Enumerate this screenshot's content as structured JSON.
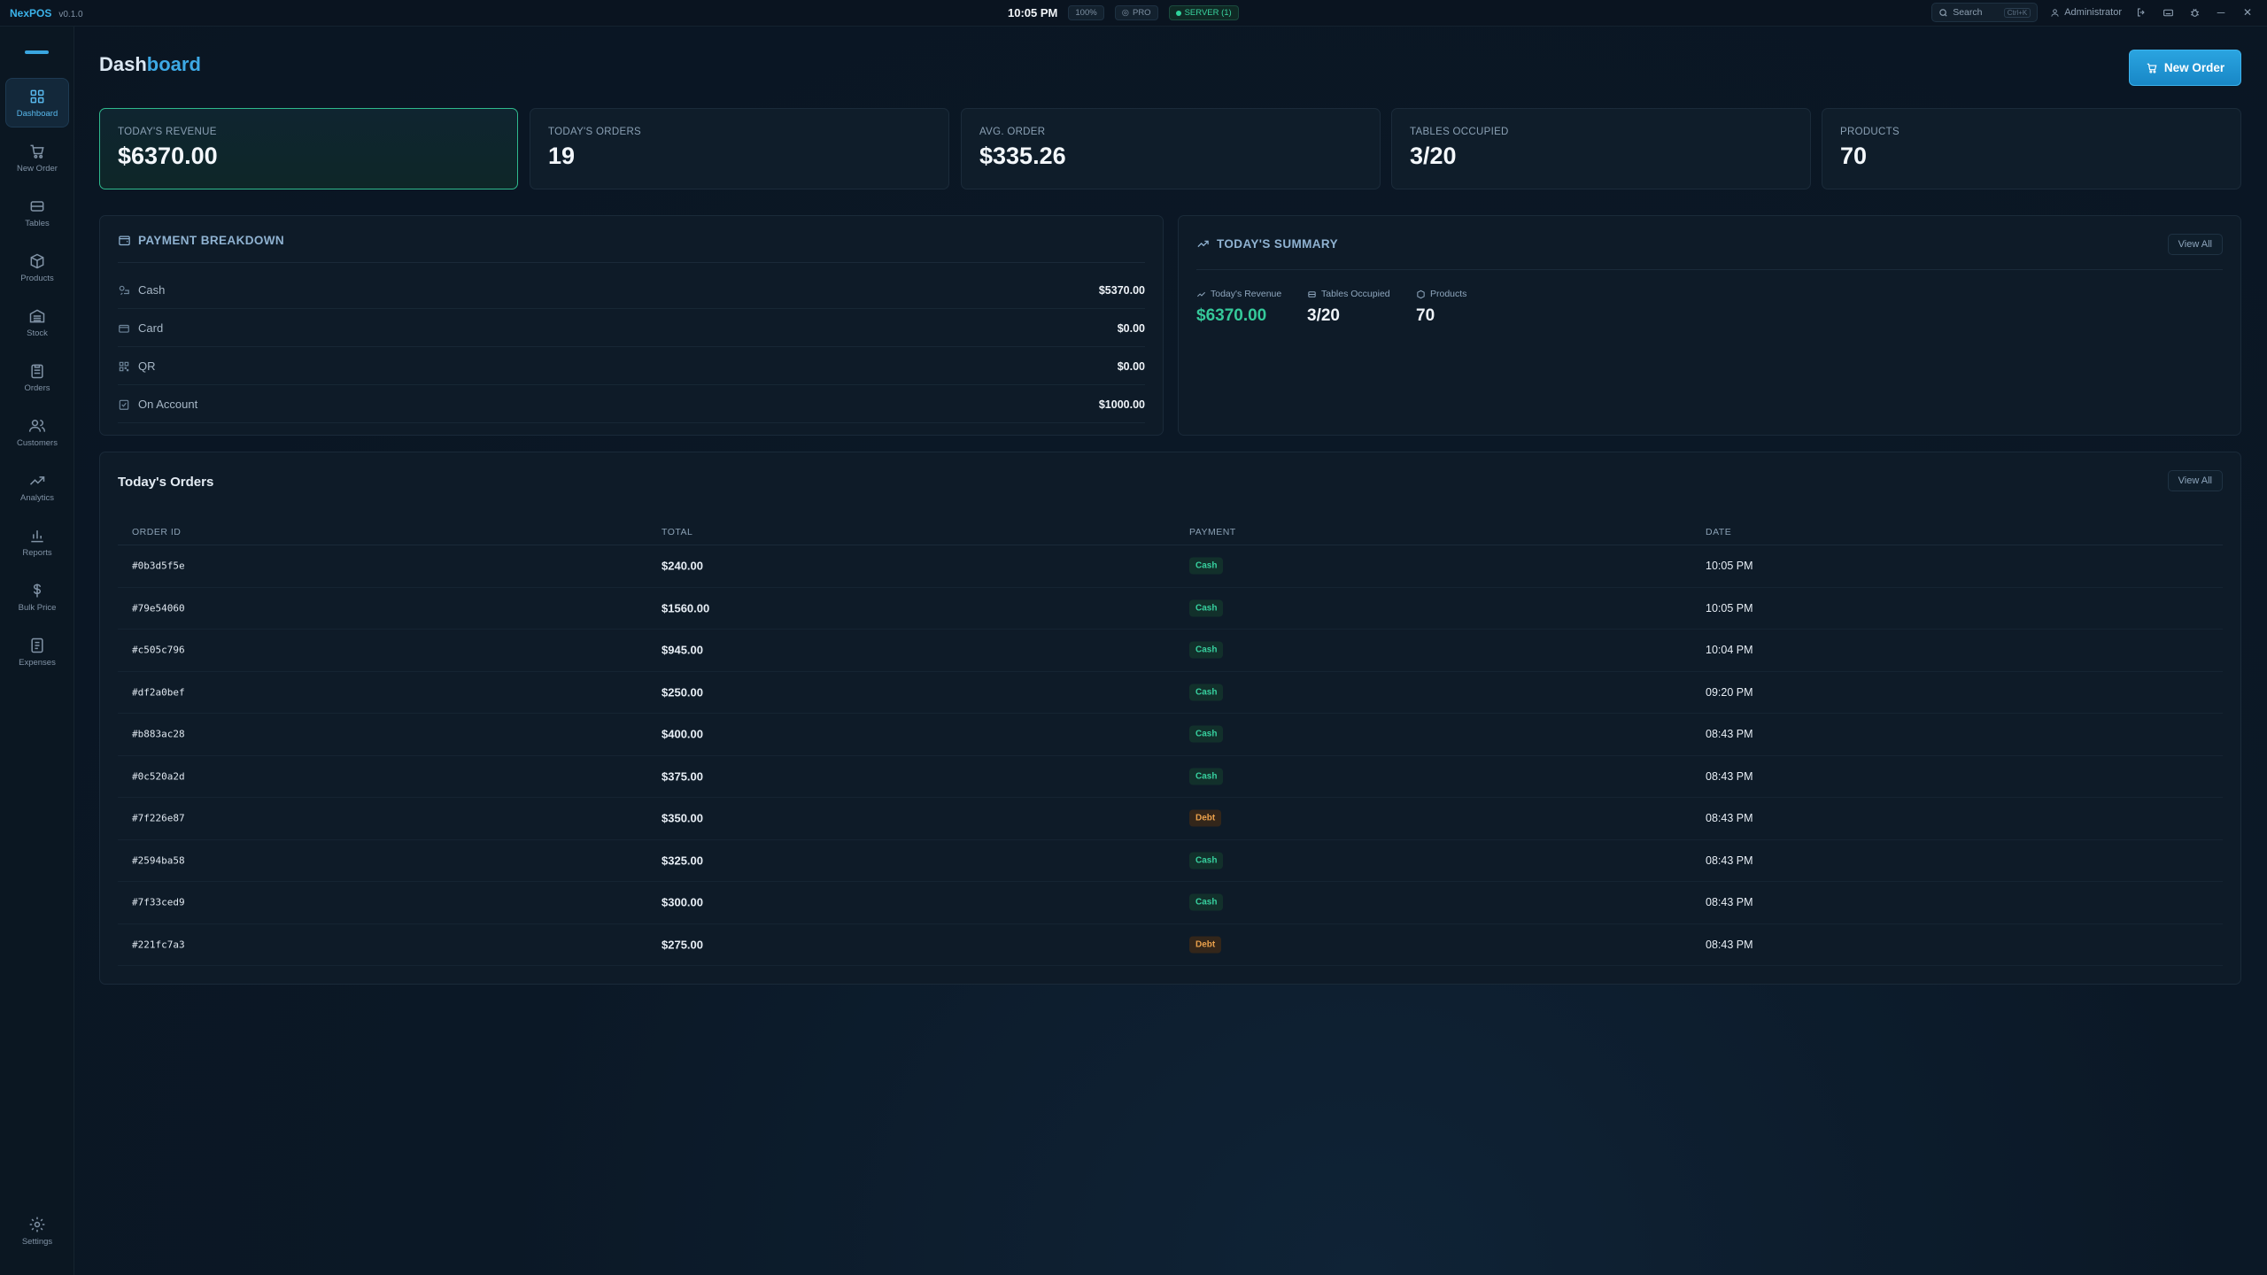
{
  "app": {
    "name": "NexPOS",
    "version": "v0.1.0"
  },
  "topbar": {
    "time": "10:05 PM",
    "zoom": "100%",
    "plan": "PRO",
    "server": "SERVER (1)",
    "search_label": "Search",
    "search_shortcut": "Ctrl+K",
    "user": "Administrator"
  },
  "sidebar": {
    "items": [
      {
        "label": "Dashboard",
        "icon": "grid-icon",
        "active": true
      },
      {
        "label": "New Order",
        "icon": "cart-icon"
      },
      {
        "label": "Tables",
        "icon": "table-icon"
      },
      {
        "label": "Products",
        "icon": "box-icon"
      },
      {
        "label": "Stock",
        "icon": "warehouse-icon"
      },
      {
        "label": "Orders",
        "icon": "clipboard-icon"
      },
      {
        "label": "Customers",
        "icon": "users-icon"
      },
      {
        "label": "Analytics",
        "icon": "trend-icon"
      },
      {
        "label": "Reports",
        "icon": "bar-chart-icon"
      },
      {
        "label": "Bulk Price",
        "icon": "dollar-icon"
      },
      {
        "label": "Expenses",
        "icon": "receipt-icon"
      }
    ],
    "settings_label": "Settings"
  },
  "page": {
    "title_a": "Dash",
    "title_b": "board",
    "new_order_label": "New Order"
  },
  "stats": [
    {
      "label": "TODAY'S REVENUE",
      "value": "$6370.00"
    },
    {
      "label": "TODAY'S ORDERS",
      "value": "19"
    },
    {
      "label": "AVG. ORDER",
      "value": "$335.26"
    },
    {
      "label": "TABLES OCCUPIED",
      "value": "3/20"
    },
    {
      "label": "PRODUCTS",
      "value": "70"
    }
  ],
  "payment_breakdown": {
    "title": "PAYMENT BREAKDOWN",
    "rows": [
      {
        "label": "Cash",
        "amount": "$5370.00"
      },
      {
        "label": "Card",
        "amount": "$0.00"
      },
      {
        "label": "QR",
        "amount": "$0.00"
      },
      {
        "label": "On Account",
        "amount": "$1000.00"
      }
    ]
  },
  "summary": {
    "title": "TODAY'S SUMMARY",
    "view_all": "View All",
    "items": [
      {
        "label": "Today's Revenue",
        "value": "$6370.00"
      },
      {
        "label": "Tables Occupied",
        "value": "3/20"
      },
      {
        "label": "Products",
        "value": "70"
      }
    ]
  },
  "orders": {
    "title": "Today's Orders",
    "view_all": "View All",
    "columns": [
      "ORDER ID",
      "TOTAL",
      "PAYMENT",
      "DATE"
    ],
    "rows": [
      {
        "id": "#0b3d5f5e",
        "total": "$240.00",
        "payment": "Cash",
        "date": "10:05 PM"
      },
      {
        "id": "#79e54060",
        "total": "$1560.00",
        "payment": "Cash",
        "date": "10:05 PM"
      },
      {
        "id": "#c505c796",
        "total": "$945.00",
        "payment": "Cash",
        "date": "10:04 PM"
      },
      {
        "id": "#df2a0bef",
        "total": "$250.00",
        "payment": "Cash",
        "date": "09:20 PM"
      },
      {
        "id": "#b883ac28",
        "total": "$400.00",
        "payment": "Cash",
        "date": "08:43 PM"
      },
      {
        "id": "#0c520a2d",
        "total": "$375.00",
        "payment": "Cash",
        "date": "08:43 PM"
      },
      {
        "id": "#7f226e87",
        "total": "$350.00",
        "payment": "Debt",
        "date": "08:43 PM"
      },
      {
        "id": "#2594ba58",
        "total": "$325.00",
        "payment": "Cash",
        "date": "08:43 PM"
      },
      {
        "id": "#7f33ced9",
        "total": "$300.00",
        "payment": "Cash",
        "date": "08:43 PM"
      },
      {
        "id": "#221fc7a3",
        "total": "$275.00",
        "payment": "Debt",
        "date": "08:43 PM"
      }
    ]
  },
  "colors": {
    "accent": "#3da9e5",
    "success": "#35c99a",
    "warning": "#e9a04b",
    "background": "#0b1826"
  }
}
